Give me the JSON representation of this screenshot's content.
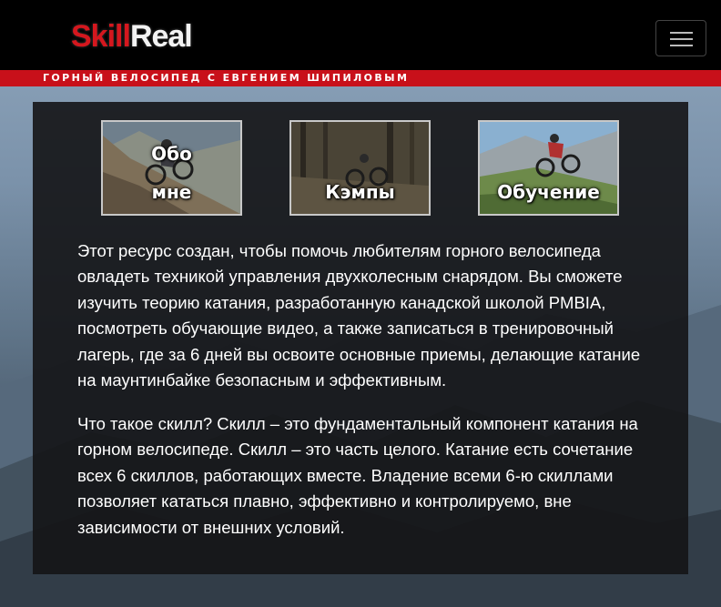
{
  "header": {
    "logo_skill": "Skill",
    "logo_real": "Real",
    "menu_icon": "hamburger-icon"
  },
  "tagline": "ГОРНЫЙ ВЕЛОСИПЕД С ЕВГЕНИЕМ ШИПИЛОВЫМ",
  "tiles": [
    {
      "line1": "Обо",
      "line2": "мне"
    },
    {
      "line1": "",
      "line2": "Кэмпы"
    },
    {
      "line1": "",
      "line2": "Обучение"
    }
  ],
  "paragraphs": [
    "Этот ресурс создан, чтобы помочь любителям горного велосипеда овладеть техникой управления двухколесным снарядом. Вы сможете изучить теорию катания, разработанную канадской школой PMBIA, посмотреть обучающие видео, а также записаться в тренировочный лагерь, где за 6 дней вы освоите основные приемы, делающие катание на маунтинбайке безопасным и эффективным.",
    "Что такое скилл? Скилл – это фундаментальный компонент катания на горном велосипеде. Скилл – это часть целого. Катание есть сочетание всех 6 скиллов, работающих вместе. Владение всеми 6-ю скиллами позволяет кататься плавно, эффективно и контролируемо, вне зависимости от внешних условий."
  ],
  "colors": {
    "brand_red": "#d4171e",
    "navbar": "#000000",
    "panel": "#141416"
  }
}
